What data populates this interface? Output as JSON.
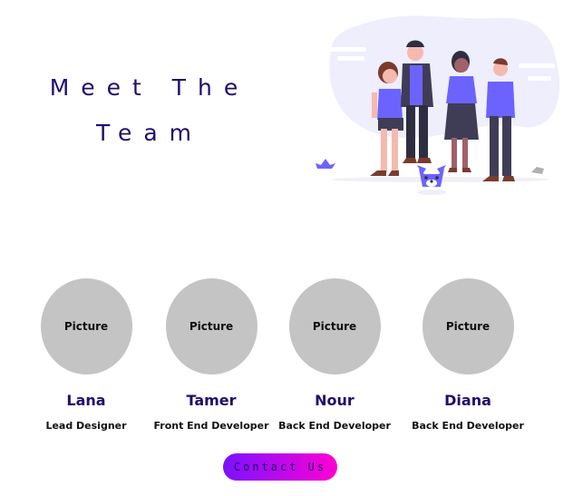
{
  "hero": {
    "title_line1": "Meet The",
    "title_line2": "Team"
  },
  "illustration": {
    "icon": "team-illustration",
    "accent_color": "#6c63ff",
    "blob_color": "#eeeefc"
  },
  "team": {
    "members": [
      {
        "picture_label": "Picture",
        "name": "Lana",
        "role": "Lead Designer"
      },
      {
        "picture_label": "Picture",
        "name": "Tamer",
        "role": "Front End Developer"
      },
      {
        "picture_label": "Picture",
        "name": "Nour",
        "role": "Back End Developer"
      },
      {
        "picture_label": "Picture",
        "name": "Diana",
        "role": "Back End Developer"
      }
    ]
  },
  "contact": {
    "label": "Contact Us",
    "gradient_start": "#7a12ff",
    "gradient_end": "#ff00d4"
  },
  "colors": {
    "heading": "#1f0f6b",
    "avatar_bg": "#c4c4c4"
  }
}
